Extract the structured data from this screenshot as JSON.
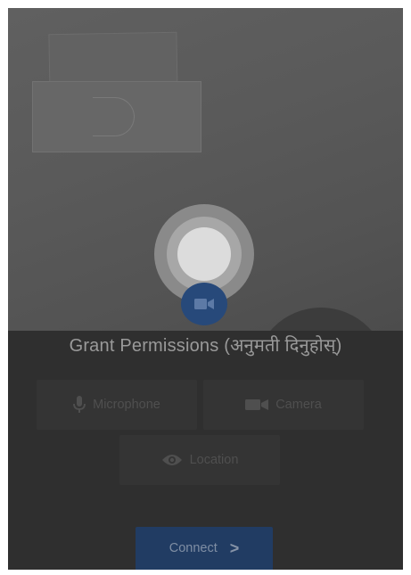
{
  "permissions": {
    "title": "Grant Permissions (अनुमती दिनुहोस्)",
    "microphone_label": "Microphone",
    "microphone_icon": "microphone-icon",
    "camera_label": "Camera",
    "camera_icon": "videocam-icon",
    "location_label": "Location",
    "location_icon": "eye-icon"
  },
  "capture": {
    "shutter_icon": "shutter-button",
    "switch_icon": "videocam-icon"
  },
  "connect": {
    "label": "Connect",
    "chevron": ">"
  },
  "colors": {
    "overlay": "#2f2f2f",
    "accent": "#213c63",
    "switch_button": "#27497a"
  }
}
